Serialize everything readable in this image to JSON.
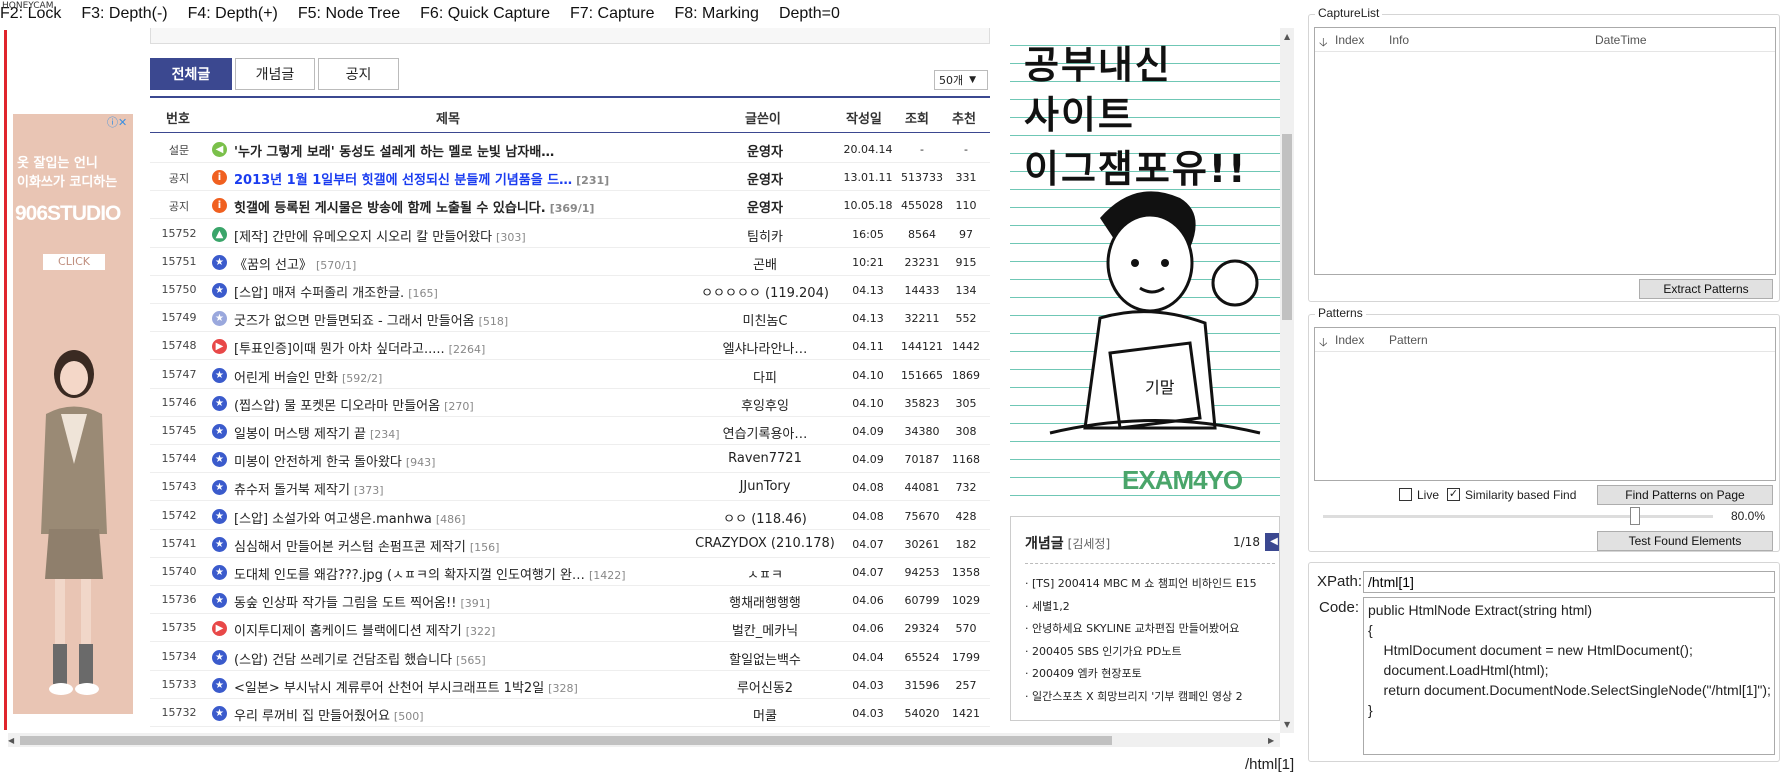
{
  "toolbar": {
    "watermark": "HONEYCAM",
    "lock": "F2: Lock",
    "depth_minus": "F3: Depth(-)",
    "depth_plus": "F4: Depth(+)",
    "node_tree": "F5: Node Tree",
    "quick_capture": "F6: Quick Capture",
    "capture": "F7: Capture",
    "marking": "F8: Marking",
    "depth": "Depth=0"
  },
  "board": {
    "tabs": [
      "전체글",
      "개념글",
      "공지"
    ],
    "page_size": "50개",
    "headers": {
      "num": "번호",
      "title": "제목",
      "writer": "글쓴이",
      "date": "작성일",
      "views": "조회",
      "rec": "추천"
    },
    "rows": [
      {
        "num": "설문",
        "icon": "speaker",
        "title": "'누가 그렇게 보래' 동성도 설레게 하는 멜로 눈빛 남자배…",
        "cnt": "",
        "writer": "운영자",
        "date": "20.04.14",
        "views": "-",
        "rec": "-",
        "kind": "notice"
      },
      {
        "num": "공지",
        "icon": "info",
        "title": "2013년 1월 1일부터 힛갤에 선정되신 분들께 기념품을 드…",
        "cnt": "[231]",
        "writer": "운영자",
        "date": "13.01.11",
        "views": "513733",
        "rec": "331",
        "kind": "notice-blue"
      },
      {
        "num": "공지",
        "icon": "info",
        "title": "힛갤에 등록된 게시물은 방송에 함께 노출될 수 있습니다.",
        "cnt": "[369/1]",
        "writer": "운영자",
        "date": "10.05.18",
        "views": "455028",
        "rec": "110",
        "kind": "notice"
      },
      {
        "num": "15752",
        "icon": "image",
        "title": "[제작] 간만에 유메오오지 시오리 칼 만들어왔다",
        "cnt": "[303]",
        "writer": "팀히카",
        "date": "16:05",
        "views": "8564",
        "rec": "97",
        "kind": "normal"
      },
      {
        "num": "15751",
        "icon": "star",
        "title": "《꿈의 선고》",
        "cnt": "[570/1]",
        "writer": "곤배",
        "date": "10:21",
        "views": "23231",
        "rec": "915",
        "kind": "normal"
      },
      {
        "num": "15750",
        "icon": "star",
        "title": "[스압] 매져 수퍼졸리 개조한글.",
        "cnt": "[165]",
        "writer": "ㅇㅇㅇㅇㅇ (119.204)",
        "date": "04.13",
        "views": "14433",
        "rec": "134",
        "kind": "normal"
      },
      {
        "num": "15749",
        "icon": "star-light",
        "title": "굿즈가 없으면 만들면되죠 - 그래서 만들어옴",
        "cnt": "[518]",
        "writer": "미친놈C",
        "date": "04.13",
        "views": "32211",
        "rec": "552",
        "kind": "normal"
      },
      {
        "num": "15748",
        "icon": "play",
        "title": "[투표인증]이때 뭔가 아차 싶더라고.....",
        "cnt": "[2264]",
        "writer": "엘샤나라안나…",
        "date": "04.11",
        "views": "144121",
        "rec": "1442",
        "kind": "normal"
      },
      {
        "num": "15747",
        "icon": "star",
        "title": "어린게 버슬인 만화",
        "cnt": "[592/2]",
        "writer": "다피",
        "date": "04.10",
        "views": "151665",
        "rec": "1869",
        "kind": "normal"
      },
      {
        "num": "15746",
        "icon": "star",
        "title": "(찝스압) 물 포켓몬 디오라마 만들어옴",
        "cnt": "[270]",
        "writer": "후잉후잉",
        "date": "04.10",
        "views": "35823",
        "rec": "305",
        "kind": "normal"
      },
      {
        "num": "15745",
        "icon": "star",
        "title": "일봉이 머스탱 제작기 끝",
        "cnt": "[234]",
        "writer": "연습기록용아…",
        "date": "04.09",
        "views": "34380",
        "rec": "308",
        "kind": "normal"
      },
      {
        "num": "15744",
        "icon": "star",
        "title": "미봉이 안전하게 한국 돌아왔다",
        "cnt": "[943]",
        "writer": "Raven7721",
        "date": "04.09",
        "views": "70187",
        "rec": "1168",
        "kind": "normal"
      },
      {
        "num": "15743",
        "icon": "star",
        "title": "츄수저 돌거북 제작기",
        "cnt": "[373]",
        "writer": "JJunTory",
        "date": "04.08",
        "views": "44081",
        "rec": "732",
        "kind": "normal"
      },
      {
        "num": "15742",
        "icon": "star",
        "title": "[스압] 소설가와 여고생은.manhwa",
        "cnt": "[486]",
        "writer": "ㅇㅇ (118.46)",
        "date": "04.08",
        "views": "75670",
        "rec": "428",
        "kind": "normal"
      },
      {
        "num": "15741",
        "icon": "star",
        "title": "심심해서 만들어본 커스텀 손펌프콘 제작기",
        "cnt": "[156]",
        "writer": "CRAZYDOX (210.178)",
        "date": "04.07",
        "views": "30261",
        "rec": "182",
        "kind": "normal"
      },
      {
        "num": "15740",
        "icon": "star",
        "title": "도대체 인도를 왜감???.jpg (ㅅㅍㅋ의 확자지껄 인도여행기 완…",
        "cnt": "[1422]",
        "writer": "ㅅㅍㅋ",
        "date": "04.07",
        "views": "94253",
        "rec": "1358",
        "kind": "normal"
      },
      {
        "num": "15736",
        "icon": "star",
        "title": "동숲 인상파 작가들 그림을 도트 찍어옴!!",
        "cnt": "[391]",
        "writer": "행채래행행행",
        "date": "04.06",
        "views": "60799",
        "rec": "1029",
        "kind": "normal"
      },
      {
        "num": "15735",
        "icon": "play",
        "title": "이지투디제이 홈케이드 블랙에디션 제작기",
        "cnt": "[322]",
        "writer": "벌칸_메카닉",
        "date": "04.06",
        "views": "29324",
        "rec": "570",
        "kind": "normal"
      },
      {
        "num": "15734",
        "icon": "star",
        "title": "(스압) 건담 쓰레기로 건담조립 했습니다",
        "cnt": "[565]",
        "writer": "할일없는백수",
        "date": "04.04",
        "views": "65524",
        "rec": "1799",
        "kind": "normal"
      },
      {
        "num": "15733",
        "icon": "star",
        "title": "<일본> 부시낚시 계류루어 산천어 부시크래프트 1박2일",
        "cnt": "[328]",
        "writer": "루어신동2",
        "date": "04.03",
        "views": "31596",
        "rec": "257",
        "kind": "normal"
      },
      {
        "num": "15732",
        "icon": "star",
        "title": "우리 루꺼비 집 만들어줬어요",
        "cnt": "[500]",
        "writer": "머쿨",
        "date": "04.03",
        "views": "54020",
        "rec": "1421",
        "kind": "normal"
      }
    ]
  },
  "left_ad": {
    "line1": "옷 잘입는 언니",
    "line2": "이화쓰가 코디하는",
    "brand": "906STUDIO",
    "cta": "CLICK",
    "info": "ⓘ✕"
  },
  "comic_ad": {
    "line1": "공부내신",
    "line2": "사이트",
    "line3": "이그잼포유!!",
    "brand": "EXAM4YO"
  },
  "concept": {
    "title": "개념글",
    "sub": "[김세정]",
    "page": "1/18",
    "items": [
      "· [TS] 200414 MBC M 쇼 챔피언 비하인드 E15",
      "· 세별1,2",
      "· 안녕하세요 SKYLINE 교차편집 만들어봤어요",
      "· 200405 SBS 인기가요 PD노트",
      "· 200409 엠카 현장포토",
      "· 일간스포츠 X 희망브리지 '기부 캠페인 영상 2"
    ]
  },
  "status_path": "/html[1]",
  "panel": {
    "capture_list": {
      "label": "CaptureList",
      "col_index": "Index",
      "col_info": "Info",
      "col_datetime": "DateTime",
      "extract_button": "Extract Patterns"
    },
    "patterns": {
      "label": "Patterns",
      "col_index": "Index",
      "col_pattern": "Pattern"
    },
    "live_label": "Live",
    "live_checked": false,
    "similarity_label": "Similarity based Find",
    "similarity_checked": true,
    "find_button": "Find Patterns on Page",
    "slider_value": "80.0%",
    "slider_fraction": 0.8,
    "test_button": "Test Found Elements",
    "xpath_label": "XPath:",
    "xpath_value": "/html[1]",
    "code_label": "Code:",
    "code_value": "public HtmlNode Extract(string html)\n{\n    HtmlDocument document = new HtmlDocument();\n    document.LoadHtml(html);\n    return document.DocumentNode.SelectSingleNode(\"/html[1]\");\n}"
  },
  "colors": {
    "accent": "#3b4890",
    "red": "#e0242c",
    "notice_blue": "#1a3cf0",
    "comic_line": "#6fc7b5"
  }
}
